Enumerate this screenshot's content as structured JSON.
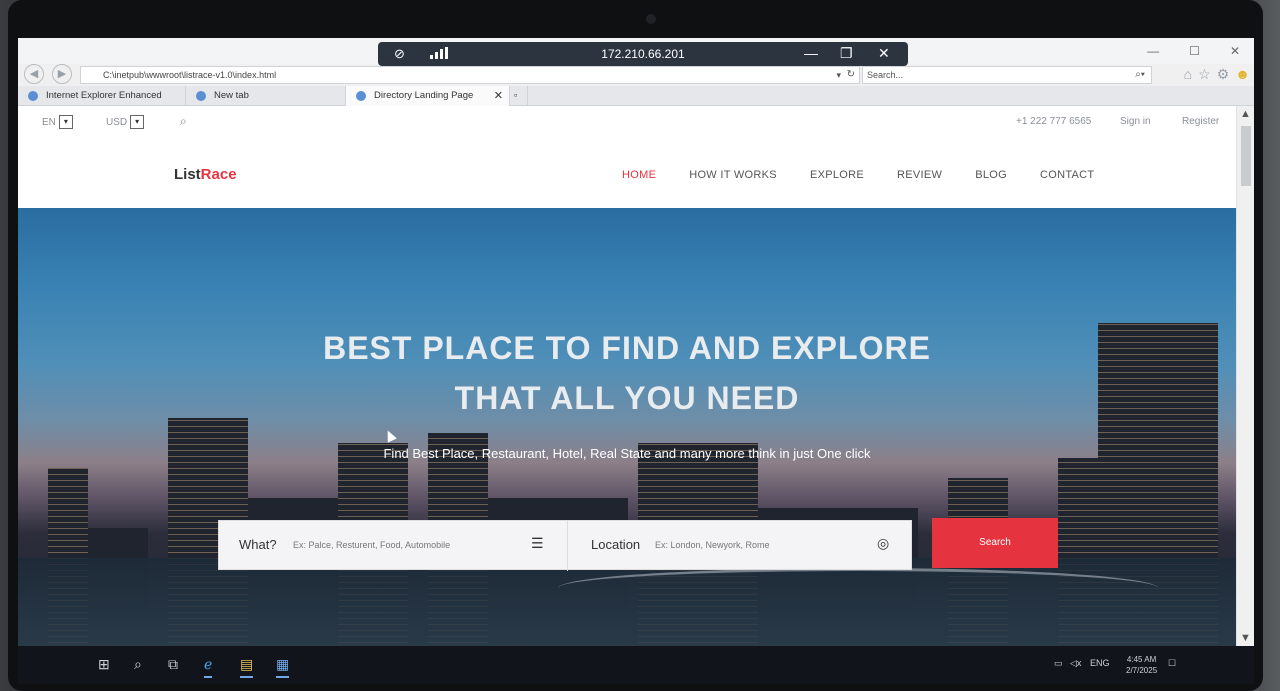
{
  "rdp": {
    "ip": "172.210.66.201"
  },
  "browser": {
    "url": "C:\\inetpub\\wwwroot\\listrace-v1.0\\index.html",
    "search_placeholder": "Search...",
    "tabs": [
      {
        "label": "Internet Explorer Enhanced Sec..."
      },
      {
        "label": "New tab"
      },
      {
        "label": "Directory Landing Page"
      }
    ]
  },
  "topbar": {
    "lang": "EN",
    "currency": "USD",
    "phone": "+1 222 777 6565",
    "signin": "Sign in",
    "register": "Register"
  },
  "nav": {
    "logo_a": "List",
    "logo_b": "Race",
    "items": [
      "HOME",
      "HOW IT WORKS",
      "EXPLORE",
      "REVIEW",
      "BLOG",
      "CONTACT"
    ],
    "active": "HOME"
  },
  "hero": {
    "title_line1": "BEST PLACE TO FIND AND EXPLORE",
    "title_line2": "THAT ALL YOU NEED",
    "subtitle": "Find Best Place, Restaurant, Hotel, Real State and many more think in just One click",
    "what_label": "What?",
    "what_placeholder": "Ex: Palce, Resturent, Food, Automobile",
    "location_label": "Location",
    "location_placeholder": "Ex: London, Newyork, Rome",
    "search_button": "Search"
  },
  "taskbar": {
    "lang": "ENG",
    "time": "4:45 AM",
    "date": "2/7/2025"
  },
  "colors": {
    "accent": "#e5343f",
    "taskbar": "#11151b",
    "rdp_bar": "#2c3440"
  }
}
